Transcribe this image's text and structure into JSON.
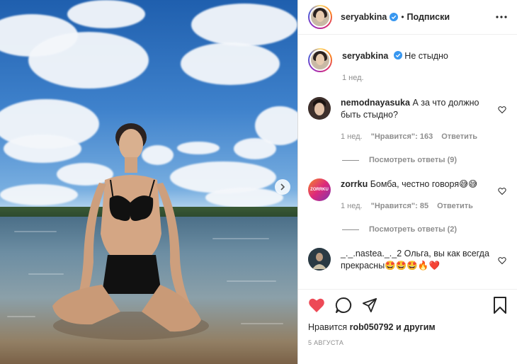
{
  "post": {
    "author": "seryabkina",
    "follow_state": "Подписки",
    "separator": "•",
    "caption": "Не стыдно",
    "caption_time": "1 нед."
  },
  "comments": [
    {
      "user": "nemodnayasuka",
      "text": "А за что должно быть стыдно?",
      "time": "1 нед.",
      "likes": "\"Нравится\": 163",
      "reply": "Ответить",
      "view_replies": "Посмотреть ответы (9)"
    },
    {
      "user": "zorrku",
      "text": "Бомба, честно говоря😅😅",
      "time": "1 нед.",
      "likes": "\"Нравится\": 85",
      "reply": "Ответить",
      "view_replies": "Посмотреть ответы (2)"
    },
    {
      "user": "_._.nastea._._2",
      "text": "Ольга, вы как всегда прекрасны🤩🤩🤩🔥❤️"
    }
  ],
  "footer": {
    "likes_prefix": "Нравится",
    "likes_user": "rob050792",
    "likes_suffix": "и другим",
    "date": "5 августа"
  },
  "icons": [
    "heart-filled-icon",
    "comment-icon",
    "share-icon",
    "bookmark-icon",
    "chevron-right-icon",
    "more-icon",
    "verified-badge-icon",
    "heart-outline-icon"
  ],
  "colors": {
    "like_red": "#ed4956",
    "verified_blue": "#3897f0",
    "muted": "#8e8e8e",
    "zorrku_avatar": "#c13584"
  }
}
